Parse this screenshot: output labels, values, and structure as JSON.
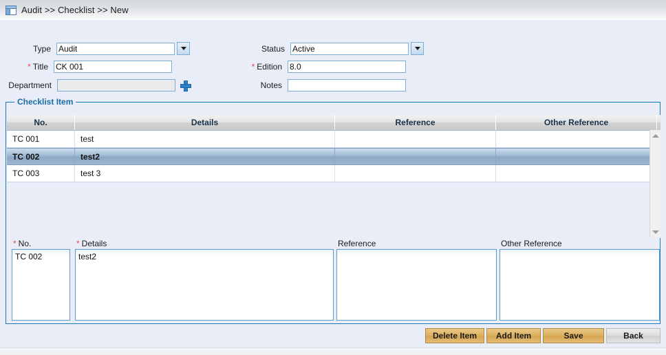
{
  "breadcrumb": {
    "icon": "window-panel-icon",
    "text": "Audit >> Checklist >> New"
  },
  "form": {
    "type": {
      "label": "Type",
      "value": "Audit",
      "required": false,
      "control": "dropdown"
    },
    "title": {
      "label": "Title",
      "value": "CK 001",
      "required": true,
      "control": "text"
    },
    "department": {
      "label": "Department",
      "value": "",
      "required": false,
      "control": "readonly-lookup",
      "add_icon": "plus-icon"
    },
    "status": {
      "label": "Status",
      "value": "Active",
      "required": false,
      "control": "dropdown"
    },
    "edition": {
      "label": "Edition",
      "value": "8.0",
      "required": true,
      "control": "text"
    },
    "notes": {
      "label": "Notes",
      "value": "",
      "required": false,
      "control": "text"
    }
  },
  "checklist": {
    "legend": "Checklist Item",
    "columns": [
      "No.",
      "Details",
      "Reference",
      "Other Reference"
    ],
    "rows": [
      {
        "no": "TC 001",
        "details": "test",
        "reference": "",
        "other_reference": "",
        "selected": false
      },
      {
        "no": "TC 002",
        "details": "test2",
        "reference": "",
        "other_reference": "",
        "selected": true
      },
      {
        "no": "TC 003",
        "details": "test 3",
        "reference": "",
        "other_reference": "",
        "selected": false
      }
    ],
    "scrollbar": {
      "up_icon": "scroll-up-arrow-icon",
      "down_icon": "scroll-down-arrow-icon"
    }
  },
  "detail": {
    "no": {
      "label": "No.",
      "required": true,
      "value": "TC 002"
    },
    "details": {
      "label": "Details",
      "required": true,
      "value": "test2"
    },
    "reference": {
      "label": "Reference",
      "required": false,
      "value": ""
    },
    "other_reference": {
      "label": "Other Reference",
      "required": false,
      "value": ""
    }
  },
  "buttons": {
    "delete_item": "Delete Item",
    "add_item": "Add Item",
    "save": "Save",
    "back": "Back"
  },
  "colors": {
    "page_bg": "#e8edf7",
    "fieldset_border": "#1a7ab5",
    "legend_text": "#1a6fa8",
    "input_border": "#7badd4",
    "required_star": "#e8483f",
    "button_gold": "#ddb163",
    "button_gray": "#dedede",
    "row_selected": "#9fb9d3"
  }
}
